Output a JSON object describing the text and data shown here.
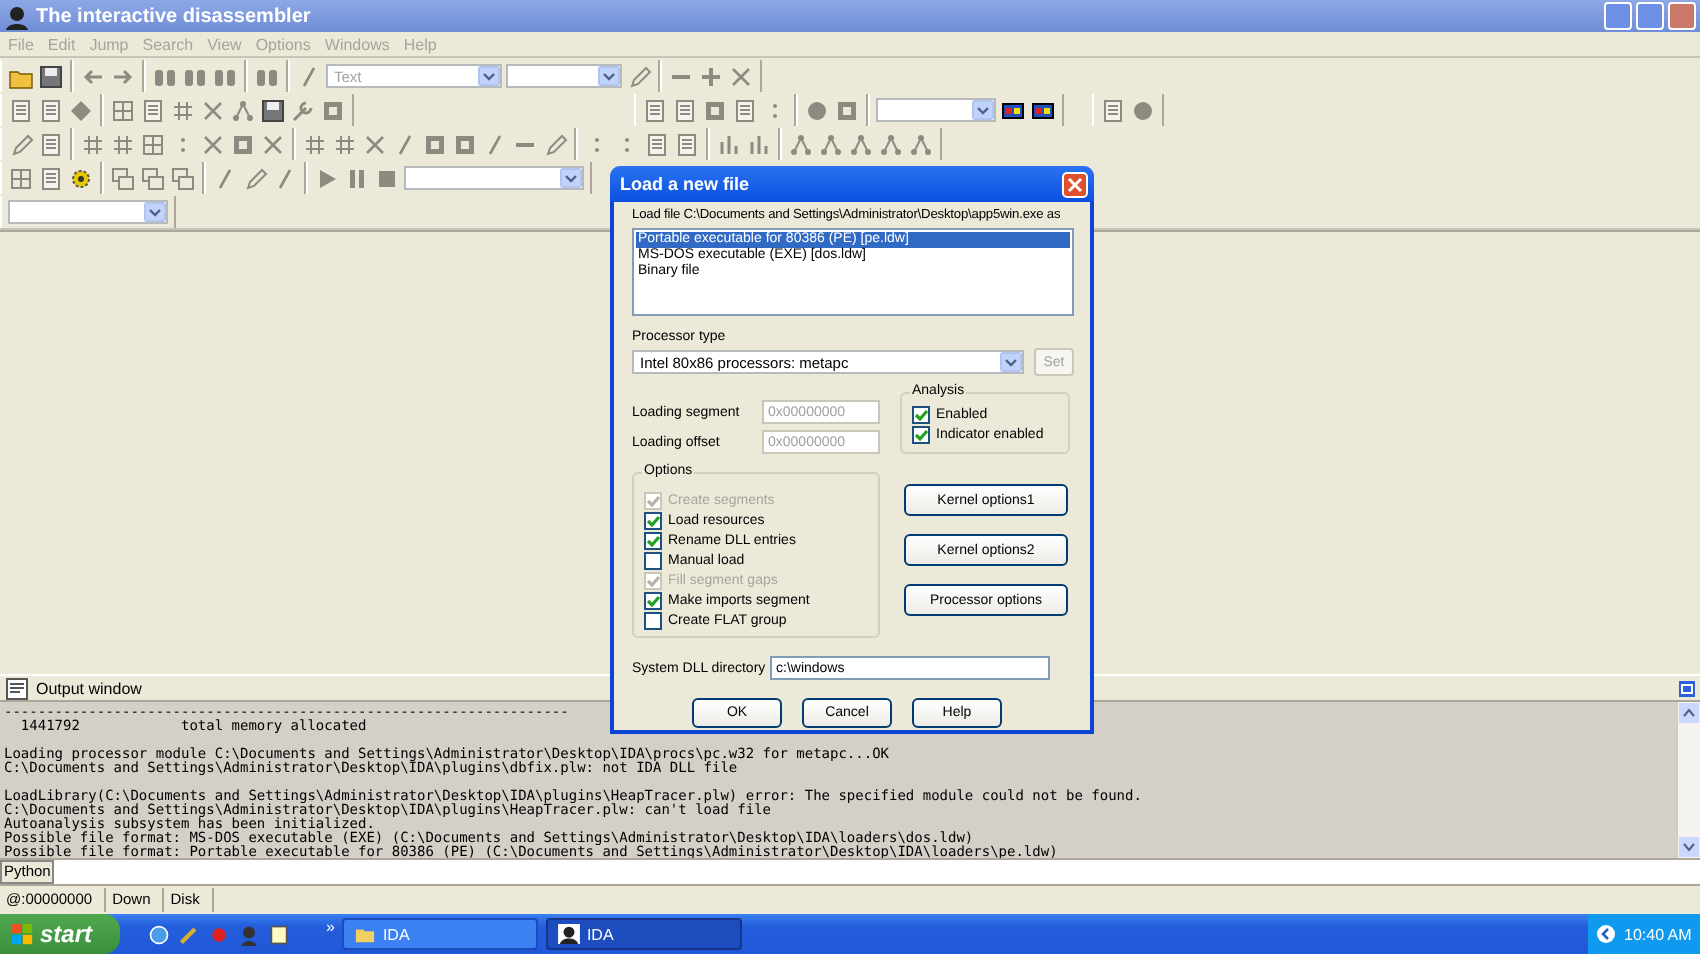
{
  "window": {
    "title": "The interactive disassembler"
  },
  "menu": [
    {
      "label": "File",
      "disabled": true
    },
    {
      "label": "Edit",
      "disabled": true
    },
    {
      "label": "Jump",
      "disabled": true
    },
    {
      "label": "Search",
      "disabled": true
    },
    {
      "label": "View",
      "disabled": true
    },
    {
      "label": "Options",
      "disabled": true
    },
    {
      "label": "Windows",
      "disabled": true
    },
    {
      "label": "Help",
      "disabled": true
    }
  ],
  "toolbar": {
    "text_combo": {
      "value": "Text",
      "disabled": true
    }
  },
  "dialog": {
    "title": "Load a new file",
    "file_label": "Load file C:\\Documents and Settings\\Administrator\\Desktop\\app5win.exe as",
    "loaders": [
      {
        "label": "Portable executable for 80386 (PE) [pe.ldw]",
        "selected": true
      },
      {
        "label": "MS-DOS executable (EXE) [dos.ldw]",
        "selected": false
      },
      {
        "label": "Binary file",
        "selected": false
      }
    ],
    "processor_label": "Processor type",
    "processor_value": "Intel 80x86 processors: metapc",
    "set_button": {
      "label": "Set",
      "disabled": true
    },
    "fields": [
      {
        "label": "Loading segment",
        "value": "0x00000000",
        "disabled": true
      },
      {
        "label": "Loading offset",
        "value": "0x00000000",
        "disabled": true
      }
    ],
    "analysis": {
      "title": "Analysis",
      "items": [
        {
          "label": "Enabled",
          "checked": true,
          "disabled": false
        },
        {
          "label": "Indicator enabled",
          "checked": true,
          "disabled": false
        }
      ]
    },
    "options": {
      "title": "Options",
      "items": [
        {
          "label": "Create segments",
          "checked": true,
          "disabled": true
        },
        {
          "label": "Load resources",
          "checked": true,
          "disabled": false
        },
        {
          "label": "Rename DLL entries",
          "checked": true,
          "disabled": false
        },
        {
          "label": "Manual load",
          "checked": false,
          "disabled": false
        },
        {
          "label": "Fill segment gaps",
          "checked": true,
          "disabled": true
        },
        {
          "label": "Make imports segment",
          "checked": true,
          "disabled": false
        },
        {
          "label": "Create FLAT group",
          "checked": false,
          "disabled": false
        }
      ]
    },
    "side_buttons": [
      "Kernel options1",
      "Kernel options2",
      "Processor options"
    ],
    "dll": {
      "label": "System DLL directory",
      "value": "c:\\windows"
    },
    "buttons": [
      "OK",
      "Cancel",
      "Help"
    ]
  },
  "output": {
    "title": "Output window",
    "blocks": [
      [
        "-------------------------------------------------------------------",
        "  1441792            total memory allocated"
      ],
      [
        "Loading processor module C:\\Documents and Settings\\Administrator\\Desktop\\IDA\\procs\\pc.w32 for metapc...OK",
        "C:\\Documents and Settings\\Administrator\\Desktop\\IDA\\plugins\\dbfix.plw: not IDA DLL file"
      ],
      [
        "LoadLibrary(C:\\Documents and Settings\\Administrator\\Desktop\\IDA\\plugins\\HeapTracer.plw) error: The specified module could not be found.",
        "C:\\Documents and Settings\\Administrator\\Desktop\\IDA\\plugins\\HeapTracer.plw: can't load file",
        "Autoanalysis subsystem has been initialized.",
        "Possible file format: MS-DOS executable (EXE) (C:\\Documents and Settings\\Administrator\\Desktop\\IDA\\loaders\\dos.ldw)",
        "Possible file format: Portable executable for 80386 (PE) (C:\\Documents and Settings\\Administrator\\Desktop\\IDA\\loaders\\pe.ldw)"
      ]
    ]
  },
  "python": {
    "label": "Python"
  },
  "status_bar": [
    "@:00000000",
    "Down",
    "Disk"
  ],
  "taskbar": {
    "start": "start",
    "chevron": "»",
    "tasks": [
      {
        "label": "IDA",
        "selected": false
      },
      {
        "label": "IDA",
        "selected": true
      }
    ],
    "clock": "10:40 AM"
  }
}
